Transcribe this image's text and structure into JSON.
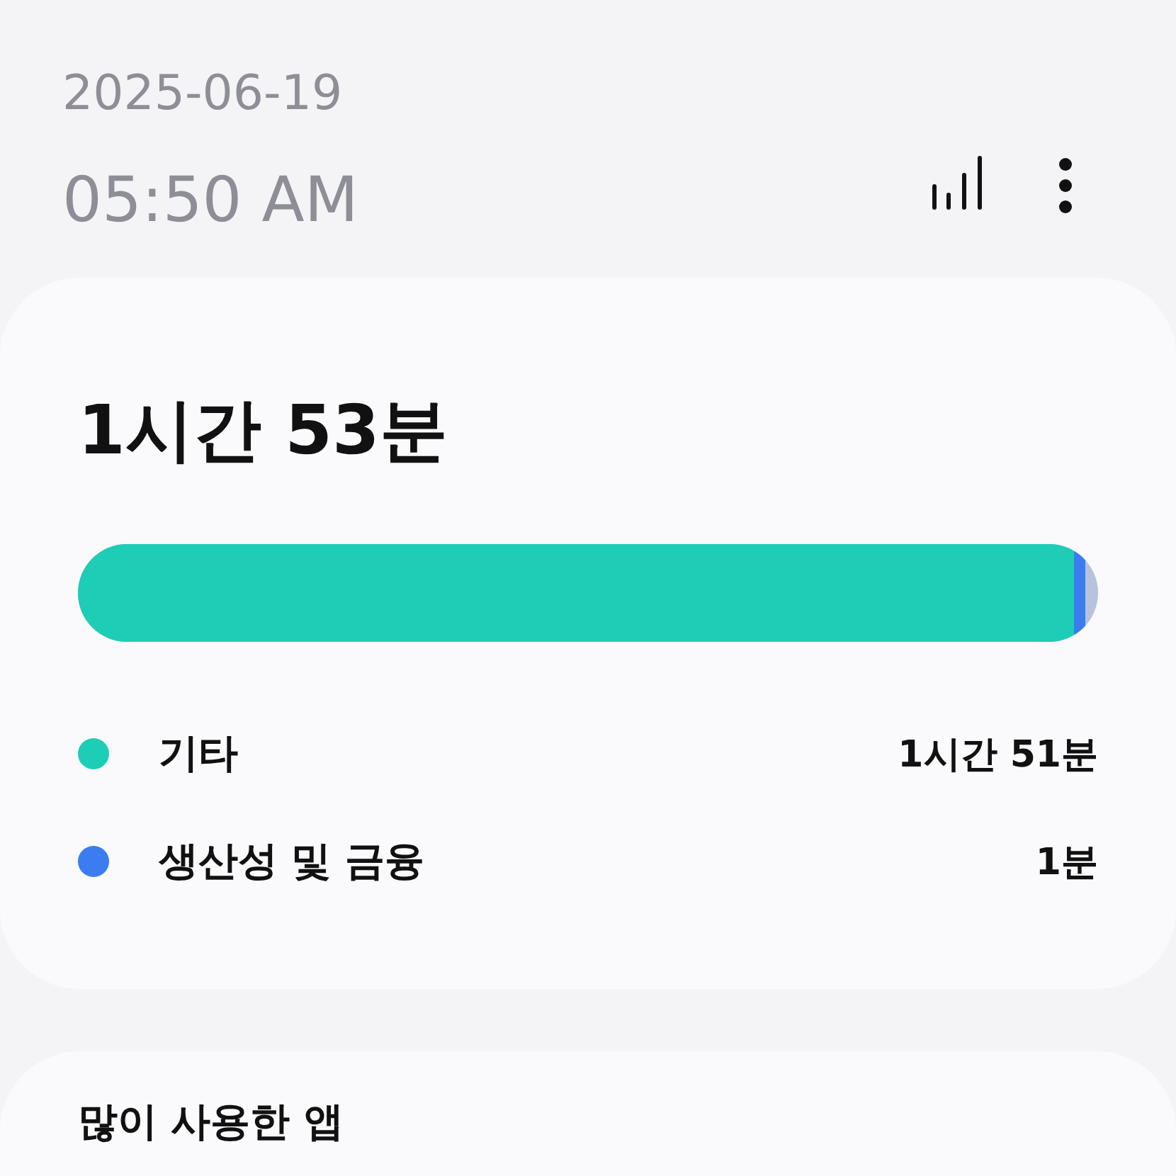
{
  "header": {
    "date": "2025-06-19",
    "time": "05:50 AM"
  },
  "summary": {
    "total": "1시간 53분",
    "categories": [
      {
        "name": "기타",
        "duration": "1시간 51분",
        "color": "#1ecdb5",
        "level": 0.976
      },
      {
        "name": "생산성 및 금융",
        "duration": "1분",
        "color": "#3b7cf0"
      }
    ]
  },
  "most_used": {
    "title": "많이 사용한 앱"
  }
}
